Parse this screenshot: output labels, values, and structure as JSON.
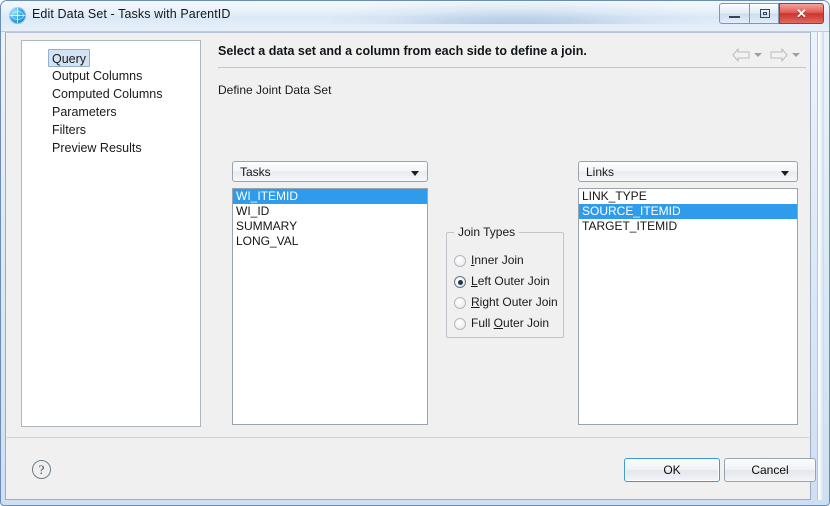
{
  "window": {
    "title": "Edit Data Set - Tasks with ParentID",
    "app_icon": "globe-icon",
    "minimize_label": "–",
    "maximize_label": "□",
    "close_label": "✕"
  },
  "sidebar": {
    "items": [
      {
        "label": "Query",
        "selected": true
      },
      {
        "label": "Output Columns",
        "selected": false
      },
      {
        "label": "Computed Columns",
        "selected": false
      },
      {
        "label": "Parameters",
        "selected": false
      },
      {
        "label": "Filters",
        "selected": false
      },
      {
        "label": "Preview Results",
        "selected": false
      }
    ]
  },
  "header": {
    "title": "Select a data set and a column from each side to define a join.",
    "subtitle": "Define Joint Data Set",
    "back_icon": "back-arrow-icon",
    "forward_icon": "forward-arrow-icon"
  },
  "left_panel": {
    "dataset": "Tasks",
    "columns": [
      {
        "name": "WI_ITEMID",
        "selected": true
      },
      {
        "name": "WI_ID",
        "selected": false
      },
      {
        "name": "SUMMARY",
        "selected": false
      },
      {
        "name": "LONG_VAL",
        "selected": false
      }
    ]
  },
  "right_panel": {
    "dataset": "Links",
    "columns": [
      {
        "name": "LINK_TYPE",
        "selected": false
      },
      {
        "name": "SOURCE_ITEMID",
        "selected": true
      },
      {
        "name": "TARGET_ITEMID",
        "selected": false
      }
    ]
  },
  "join_types": {
    "legend": "Join Types",
    "options": [
      {
        "pre": "",
        "mnemonic": "I",
        "post": "nner Join",
        "selected": false
      },
      {
        "pre": "",
        "mnemonic": "L",
        "post": "eft Outer Join",
        "selected": true
      },
      {
        "pre": "",
        "mnemonic": "R",
        "post": "ight Outer Join",
        "selected": false
      },
      {
        "pre": "Full ",
        "mnemonic": "O",
        "post": "uter Join",
        "selected": false
      }
    ]
  },
  "footer": {
    "help_label": "?",
    "ok_label": "OK",
    "cancel_label": "Cancel"
  },
  "colors": {
    "selection_blue": "#2f9ceb",
    "sidebar_selection": "#d3e3f5",
    "focus_blue": "#3c9ad4",
    "close_red": "#cc342c"
  }
}
